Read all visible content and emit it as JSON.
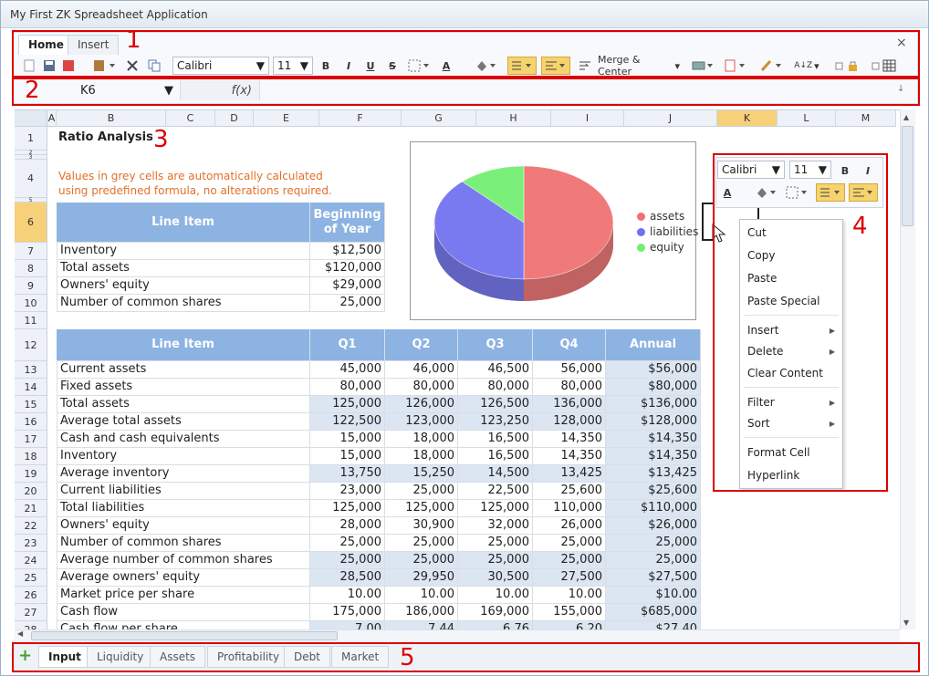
{
  "window": {
    "title": "My First ZK Spreadsheet Application"
  },
  "ribbon": {
    "tabs": [
      "Home",
      "Insert"
    ],
    "close_glyph": "×",
    "font_name": "Calibri",
    "font_size": "11",
    "bold": "B",
    "italic": "I",
    "underline": "U",
    "strike": "S",
    "font_color_glyph": "A",
    "sort_glyph": "A↓Z",
    "merge_label": "Merge & Center"
  },
  "formula_bar": {
    "cell_ref": "K6",
    "fx": "f(x)",
    "value": ""
  },
  "grid": {
    "columns": [
      "A",
      "B",
      "C",
      "D",
      "E",
      "F",
      "G",
      "H",
      "I",
      "J",
      "K",
      "L",
      "M"
    ],
    "title": "Ratio Analysis",
    "note": "Values in grey cells are automatically calculated using predefined formula, no alterations required.",
    "table1": {
      "headers": [
        "Line Item",
        "Beginning of Year"
      ],
      "rows": [
        {
          "r": "7",
          "item": "Inventory",
          "v": "$12,500"
        },
        {
          "r": "8",
          "item": "Total assets",
          "v": "$120,000"
        },
        {
          "r": "9",
          "item": "Owners' equity",
          "v": "$29,000"
        },
        {
          "r": "10",
          "item": "Number of common shares",
          "v": "25,000"
        }
      ]
    },
    "table2": {
      "headers": [
        "Line Item",
        "Q1",
        "Q2",
        "Q3",
        "Q4",
        "Annual"
      ],
      "rows": [
        {
          "r": "13",
          "item": "Current assets",
          "v": [
            "45,000",
            "46,000",
            "46,500",
            "56,000",
            "$56,000"
          ],
          "shade": false
        },
        {
          "r": "14",
          "item": "Fixed assets",
          "v": [
            "80,000",
            "80,000",
            "80,000",
            "80,000",
            "$80,000"
          ],
          "shade": false
        },
        {
          "r": "15",
          "item": "Total assets",
          "v": [
            "125,000",
            "126,000",
            "126,500",
            "136,000",
            "$136,000"
          ],
          "shade": true
        },
        {
          "r": "16",
          "item": "Average total assets",
          "v": [
            "122,500",
            "123,000",
            "123,250",
            "128,000",
            "$128,000"
          ],
          "shade": true
        },
        {
          "r": "17",
          "item": "Cash and cash equivalents",
          "v": [
            "15,000",
            "18,000",
            "16,500",
            "14,350",
            "$14,350"
          ],
          "shade": false
        },
        {
          "r": "18",
          "item": "Inventory",
          "v": [
            "15,000",
            "18,000",
            "16,500",
            "14,350",
            "$14,350"
          ],
          "shade": false
        },
        {
          "r": "19",
          "item": "Average inventory",
          "v": [
            "13,750",
            "15,250",
            "14,500",
            "13,425",
            "$13,425"
          ],
          "shade": true
        },
        {
          "r": "20",
          "item": "Current liabilities",
          "v": [
            "23,000",
            "25,000",
            "22,500",
            "25,600",
            "$25,600"
          ],
          "shade": false
        },
        {
          "r": "21",
          "item": "Total liabilities",
          "v": [
            "125,000",
            "125,000",
            "125,000",
            "110,000",
            "$110,000"
          ],
          "shade": false
        },
        {
          "r": "22",
          "item": "Owners' equity",
          "v": [
            "28,000",
            "30,900",
            "32,000",
            "26,000",
            "$26,000"
          ],
          "shade": false
        },
        {
          "r": "23",
          "item": "Number of common shares",
          "v": [
            "25,000",
            "25,000",
            "25,000",
            "25,000",
            "25,000"
          ],
          "shade": false
        },
        {
          "r": "24",
          "item": "Average number of common shares",
          "v": [
            "25,000",
            "25,000",
            "25,000",
            "25,000",
            "25,000"
          ],
          "shade": true
        },
        {
          "r": "25",
          "item": "Average owners' equity",
          "v": [
            "28,500",
            "29,950",
            "30,500",
            "27,500",
            "$27,500"
          ],
          "shade": true
        },
        {
          "r": "26",
          "item": "Market price per share",
          "v": [
            "10.00",
            "10.00",
            "10.00",
            "10.00",
            "$10.00"
          ],
          "shade": false
        },
        {
          "r": "27",
          "item": "Cash flow",
          "v": [
            "175,000",
            "186,000",
            "169,000",
            "155,000",
            "$685,000"
          ],
          "shade": false
        },
        {
          "r": "28",
          "item": "Cash flow per share",
          "v": [
            "7.00",
            "7.44",
            "6.76",
            "6.20",
            "$27.40"
          ],
          "shade": true
        }
      ]
    },
    "rows_top": [
      "1",
      "2",
      "3",
      "4",
      "5",
      "6",
      "11",
      "12"
    ]
  },
  "chart": {
    "legend": [
      {
        "label": "assets",
        "color": "#f07070"
      },
      {
        "label": "liabilities",
        "color": "#6f70f0"
      },
      {
        "label": "equity",
        "color": "#70f070"
      }
    ],
    "slices": [
      {
        "name": "assets",
        "value": 120000,
        "color": "#f07a7a"
      },
      {
        "name": "liabilities",
        "value": 91000,
        "color": "#7a7af0"
      },
      {
        "name": "equity",
        "value": 29000,
        "color": "#7af07a"
      }
    ]
  },
  "mini_toolbar": {
    "font_name": "Calibri",
    "font_size": "11",
    "bold": "B",
    "italic": "I",
    "font_color_glyph": "A"
  },
  "context_menu": {
    "items": [
      {
        "label": "Cut",
        "sub": false
      },
      {
        "label": "Copy",
        "sub": false
      },
      {
        "label": "Paste",
        "sub": false
      },
      {
        "label": "Paste Special",
        "sub": false
      },
      {
        "label": "Insert",
        "sub": true
      },
      {
        "label": "Delete",
        "sub": true
      },
      {
        "label": "Clear Content",
        "sub": false
      },
      {
        "label": "Filter",
        "sub": true
      },
      {
        "label": "Sort",
        "sub": true
      },
      {
        "label": "Format Cell",
        "sub": false
      },
      {
        "label": "Hyperlink",
        "sub": false
      }
    ],
    "submenu_glyph": "▶"
  },
  "sheets": {
    "add_glyph": "+",
    "tabs": [
      "Input",
      "Liquidity",
      "Assets",
      "Profitability",
      "Debt",
      "Market"
    ]
  },
  "annotations": [
    "1",
    "2",
    "3",
    "4",
    "5"
  ]
}
